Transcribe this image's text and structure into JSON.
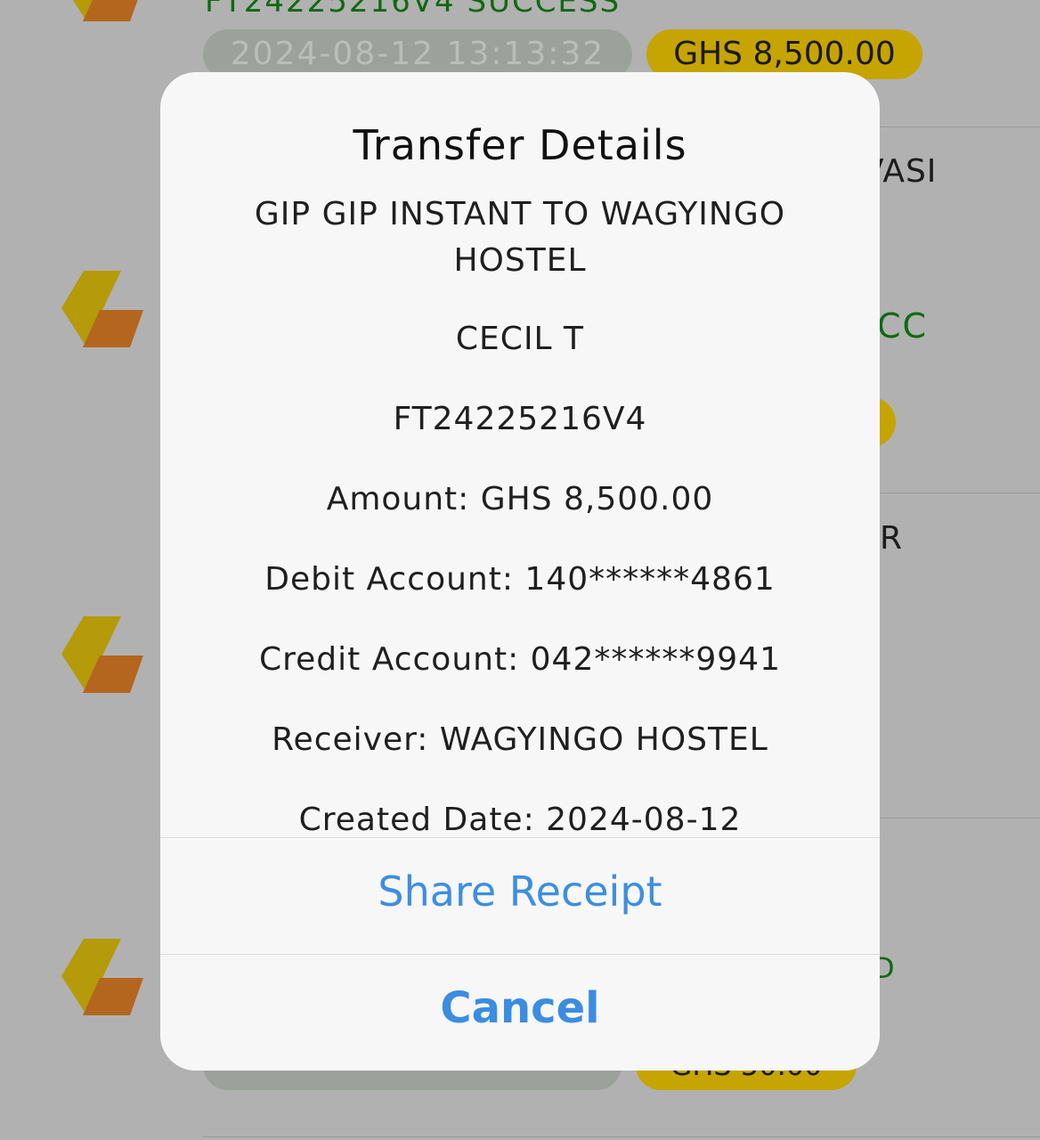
{
  "background": {
    "top_reference": "FT24225216V4 SUCCESS",
    "top_date": "2024-08-12 13:13:32",
    "top_amount": "GHS 8,500.00",
    "row2_title_fragment": "VASI",
    "row2_status_fragment": "CC",
    "row3_title_fragment": "R",
    "row4_status_fragment": "D",
    "row4_amount_fragment": "GHS 50.00"
  },
  "modal": {
    "title": "Transfer Details",
    "description": "GIP GIP INSTANT TO WAGYINGO HOSTEL",
    "name": "CECIL T",
    "reference": "FT24225216V4",
    "amount": "Amount: GHS 8,500.00",
    "debit_account": "Debit Account: 140******4861",
    "credit_account": "Credit Account: 042******9941",
    "receiver": "Receiver: WAGYINGO HOSTEL",
    "created_date": "Created Date: 2024-08-12",
    "share_label": "Share Receipt",
    "cancel_label": "Cancel"
  },
  "colors": {
    "overlay": "#b1b1b1",
    "accent_blue": "#3e8ee0",
    "success_green": "#0e6a10",
    "amount_gold": "#c6a402",
    "logo_gold": "#c7a602",
    "logo_orange": "#c0621a"
  },
  "icons": [
    "bank-logo-icon"
  ]
}
